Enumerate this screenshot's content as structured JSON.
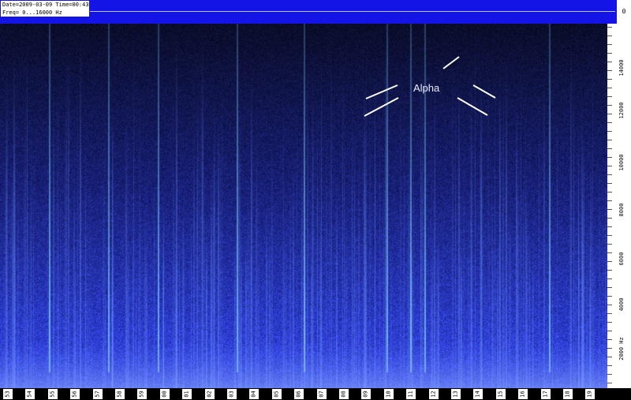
{
  "header": {
    "date_line": "Date=2009-03-09 Time=00:43",
    "freq_line": "Freq= 0...16000 Hz",
    "level_label": "0"
  },
  "freq_axis": {
    "labels": [
      "14000",
      "12000",
      "10000",
      "8000",
      "6000",
      "4000",
      "2000 Hz"
    ]
  },
  "time_axis": {
    "labels": [
      "53",
      "54",
      "55",
      "56",
      "57",
      "58",
      "59",
      "00",
      "01",
      "02",
      "03",
      "04",
      "05",
      "06",
      "07",
      "08",
      "09",
      "10",
      "11",
      "12",
      "13",
      "14",
      "15",
      "16",
      "17",
      "18",
      "19"
    ]
  },
  "annotation": {
    "label": "Alpha"
  },
  "colors": {
    "header_bar": "#1414e6",
    "spectrogram_base": "#0b0f55",
    "spectrogram_line": "#7fa8ff"
  }
}
